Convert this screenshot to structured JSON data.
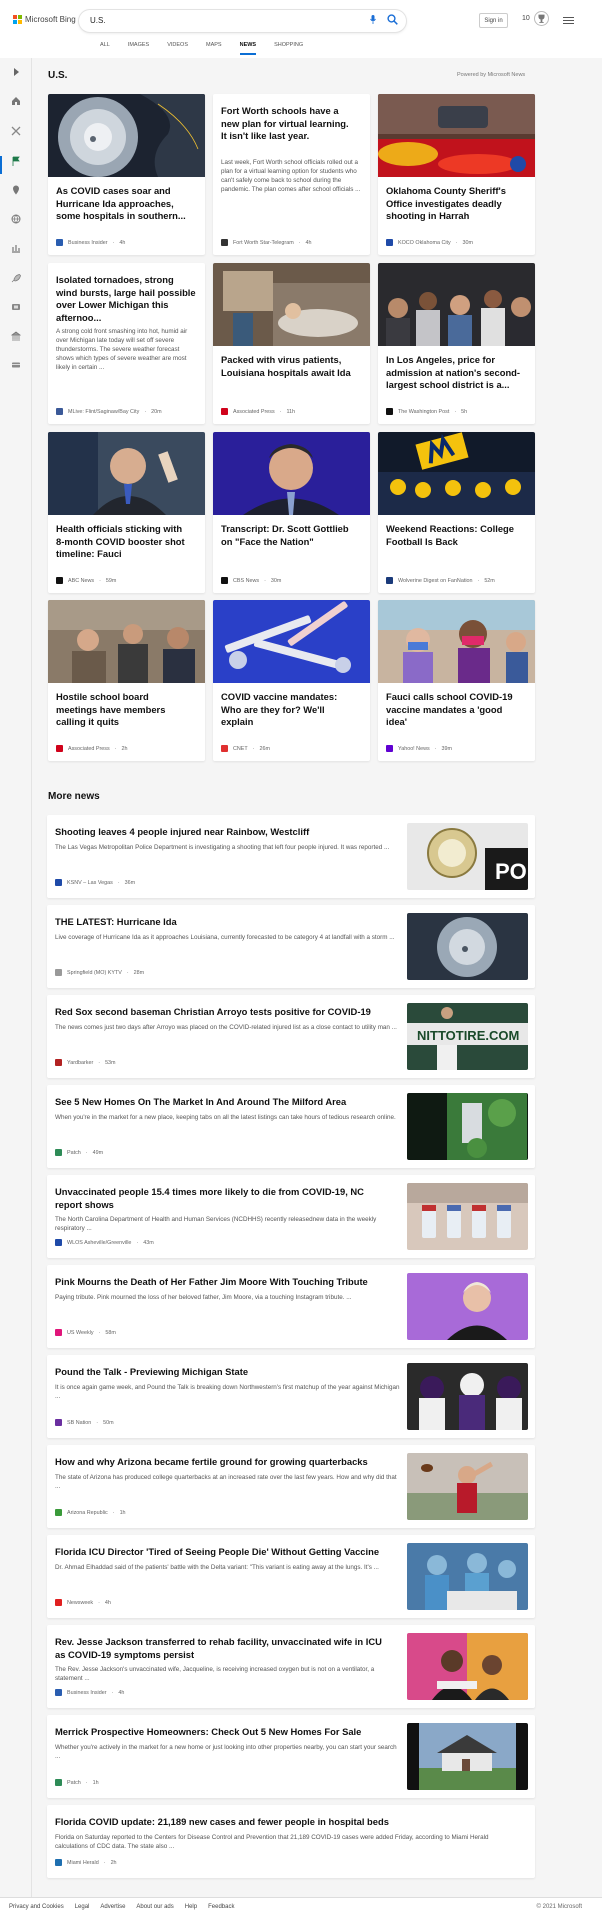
{
  "brand": {
    "name": "Microsoft Bing"
  },
  "search": {
    "query": "U.S."
  },
  "header": {
    "sign_in": "Sign in",
    "rewards_count": "10"
  },
  "scopes": [
    "ALL",
    "IMAGES",
    "VIDEOS",
    "MAPS",
    "NEWS",
    "SHOPPING"
  ],
  "active_scope": "NEWS",
  "section": {
    "title": "U.S.",
    "powered_by": "Powered by Microsoft News"
  },
  "cards": [
    {
      "title": "As COVID cases soar and Hurricane Ida approaches, some hospitals in southern...",
      "source": "Business Insider",
      "age": "4h",
      "color": "#2a5db0",
      "has_image": true
    },
    {
      "title": "Fort Worth schools have a new plan for virtual learning. It isn't like last year.",
      "desc": "Last week, Fort Worth school officials rolled out a plan for a virtual learning option for students who can't safely come back to school during the pandemic. The plan comes after school officials ...",
      "source": "Fort Worth Star-Telegram",
      "age": "4h",
      "color": "#333333",
      "has_image": false
    },
    {
      "title": "Oklahoma County Sheriff's Office investigates deadly shooting in Harrah",
      "source": "KOCO Oklahoma City",
      "age": "30m",
      "color": "#1f4aa8",
      "has_image": true
    },
    {
      "title": "Isolated tornadoes, strong wind bursts, large hail possible over Lower Michigan this afternoo...",
      "desc": "A strong cold front smashing into hot, humid air over Michigan late today will set off severe thunderstorms. The severe weather forecast shows which types of severe weather are most likely in certain ...",
      "source": "MLive: Flint/Saginaw/Bay City",
      "age": "20m",
      "color": "#3b5998",
      "has_image": false
    },
    {
      "title": "Packed with virus patients, Louisiana hospitals await Ida",
      "source": "Associated Press",
      "age": "11h",
      "color": "#d0021b",
      "has_image": true
    },
    {
      "title": "In Los Angeles, price for admission at nation's second-largest school district is a...",
      "source": "The Washington Post",
      "age": "5h",
      "color": "#111111",
      "has_image": true
    },
    {
      "title": "Health officials sticking with 8-month COVID booster shot timeline: Fauci",
      "source": "ABC News",
      "age": "59m",
      "color": "#111111",
      "has_image": true
    },
    {
      "title": "Transcript: Dr. Scott Gottlieb on \"Face the Nation\"",
      "source": "CBS News",
      "age": "30m",
      "color": "#111111",
      "has_image": true
    },
    {
      "title": "Weekend Reactions: College Football Is Back",
      "source": "Wolverine Digest on FanNation",
      "age": "52m",
      "color": "#1a3a7a",
      "has_image": true
    },
    {
      "title": "Hostile school board meetings have members calling it quits",
      "source": "Associated Press",
      "age": "2h",
      "color": "#d0021b",
      "has_image": true
    },
    {
      "title": "COVID vaccine mandates: Who are they for? We'll explain",
      "source": "CNET",
      "age": "26m",
      "color": "#e03030",
      "has_image": true
    },
    {
      "title": "Fauci calls school COVID-19 vaccine mandates a 'good idea'",
      "source": "Yahoo! News",
      "age": "39m",
      "color": "#6001d2",
      "has_image": true
    }
  ],
  "more_news": {
    "title": "More news"
  },
  "rows": [
    {
      "title": "Shooting leaves 4 people injured near Rainbow, Westcliff",
      "desc": "The Las Vegas Metropolitan Police Department is investigating a shooting that left four people injured. It was reported ...",
      "source": "KSNV – Las Vegas",
      "age": "36m",
      "color": "#1f4aa8"
    },
    {
      "title": "THE LATEST: Hurricane Ida",
      "desc": "Live coverage of Hurricane Ida as it approaches Louisiana, currently forecasted to be category 4 at landfall with a storm ...",
      "source": "Springfield (MO) KYTV",
      "age": "28m",
      "color": "#999999"
    },
    {
      "title": "Red Sox second baseman Christian Arroyo tests positive for COVID-19",
      "desc": "The news comes just two days after Arroyo was placed on the COVID-related injured list as a close contact to utility man ...",
      "source": "Yardbarker",
      "age": "53m",
      "color": "#b22222"
    },
    {
      "title": "See 5 New Homes On The Market In And Around The Milford Area",
      "desc": "When you're in the market for a new place, keeping tabs on all the latest listings can take hours of tedious research online.",
      "source": "Patch",
      "age": "49m",
      "color": "#2e8b57"
    },
    {
      "title": "Unvaccinated people 15.4 times more likely to die from COVID-19, NC report shows",
      "desc": "The North Carolina Department of Health and Human Services (NCDHHS) recently releasednew data in the weekly respiratory ...",
      "source": "WLOS Asheville/Greenville",
      "age": "43m",
      "color": "#1f4aa8"
    },
    {
      "title": "Pink Mourns the Death of Her Father Jim Moore With Touching Tribute",
      "desc": "Paying tribute. Pink mourned the loss of her beloved father, Jim Moore, via a touching Instagram tribute. ...",
      "source": "US Weekly",
      "age": "58m",
      "color": "#e0157a"
    },
    {
      "title": "Pound the Talk - Previewing Michigan State",
      "desc": "It is once again game week, and Pound the Talk is breaking down Northwestern's first matchup of the year against Michigan ...",
      "source": "SB Nation",
      "age": "50m",
      "color": "#6a2fa0"
    },
    {
      "title": "How and why Arizona became fertile ground for growing quarterbacks",
      "desc": "The state of Arizona has produced college quarterbacks at an increased rate over the last few years. How and why did that ...",
      "source": "Arizona Republic",
      "age": "1h",
      "color": "#3a9a3a"
    },
    {
      "title": "Florida ICU Director 'Tired of Seeing People Die' Without Getting Vaccine",
      "desc": "Dr. Ahmad Elhaddad said of the patients' battle with the Delta variant: \"This variant is eating away at the lungs. It's ...",
      "source": "Newsweek",
      "age": "4h",
      "color": "#e02020"
    },
    {
      "title": "Rev. Jesse Jackson transferred to rehab facility, unvaccinated wife in ICU as COVID-19 symptoms persist",
      "desc": "The Rev. Jesse Jackson's unvaccinated wife, Jacqueline, is receiving increased oxygen but is not on a ventilator, a statement ...",
      "source": "Business Insider",
      "age": "4h",
      "color": "#2a5db0"
    },
    {
      "title": "Merrick Prospective Homeowners: Check Out 5 New Homes For Sale",
      "desc": "Whether you're actively in the market for a new home or just looking into other properties nearby, you can start your search ...",
      "source": "Patch",
      "age": "1h",
      "color": "#2e8b57"
    },
    {
      "title": "Florida COVID update: 21,189 new cases and fewer people in hospital beds",
      "desc": "Florida on Saturday reported to the Centers for Disease Control and Prevention that 21,189 COVID-19 cases were added Friday, according to Miami Herald calculations of CDC data. The state also ...",
      "source": "Miami Herald",
      "age": "2h",
      "color": "#1f6fb0"
    }
  ],
  "footer": {
    "links": [
      "Privacy and Cookies",
      "Legal",
      "Advertise",
      "About our ads",
      "Help",
      "Feedback"
    ],
    "copyright": "© 2021 Microsoft"
  }
}
